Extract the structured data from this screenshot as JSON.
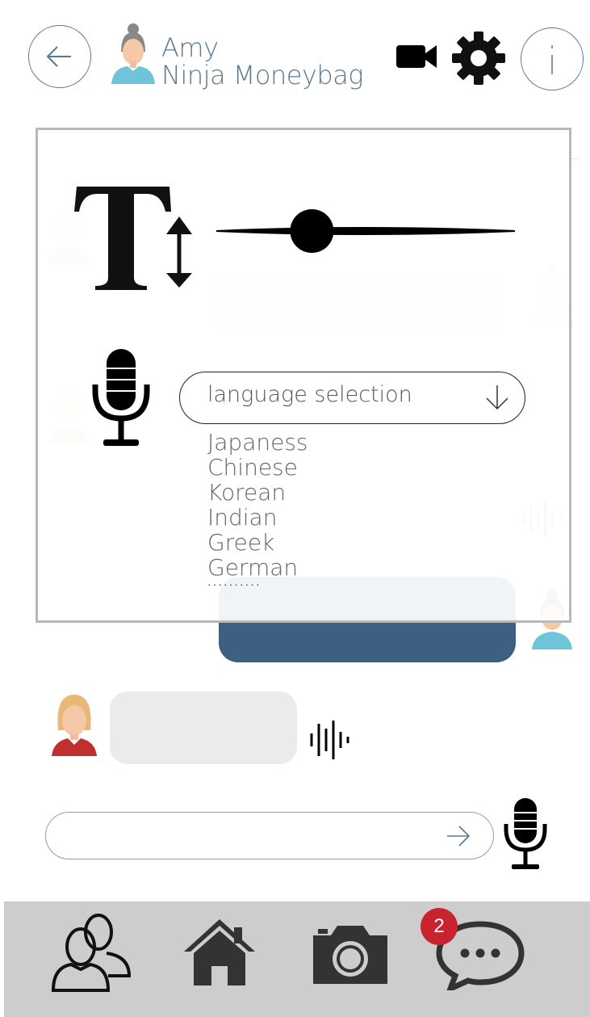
{
  "header": {
    "contact_first": "Amy",
    "contact_second": "Ninja Moneybag"
  },
  "settings_overlay": {
    "font_size_slider_value": 0.32,
    "language_dropdown": {
      "placeholder": "language selection",
      "options": [
        "Japaness",
        "Chinese",
        "Korean",
        "Indian",
        "Greek",
        "German"
      ],
      "more_indicator": "··········"
    }
  },
  "bottom_nav": {
    "items": [
      "contacts-icon",
      "home-icon",
      "camera-icon",
      "chat-icon"
    ],
    "chat_badge": "2"
  },
  "colors": {
    "accent": "#5a7890",
    "sent_bubble": "#3d5f82",
    "badge": "#c8232f",
    "bottom_bar": "#cdcdcd"
  }
}
